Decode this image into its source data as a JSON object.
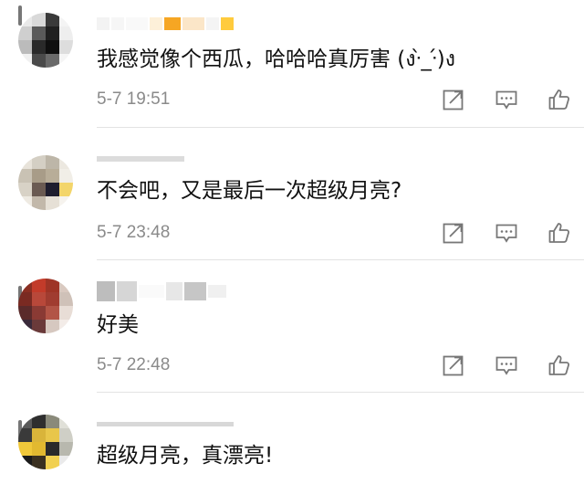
{
  "comments": [
    {
      "text": "我感觉像个西瓜，哈哈哈真厉害 (งᐧ̀_ᐧ́)ง",
      "time": "5-7 19:51"
    },
    {
      "text": "不会吧，又是最后一次超级月亮?",
      "time": "5-7 23:48"
    },
    {
      "text": "好美",
      "time": "5-7 22:48"
    },
    {
      "text": "超级月亮，真漂亮!",
      "time": ""
    }
  ],
  "icons": {
    "share": "share-icon",
    "comment": "comment-icon",
    "like": "like-icon"
  }
}
